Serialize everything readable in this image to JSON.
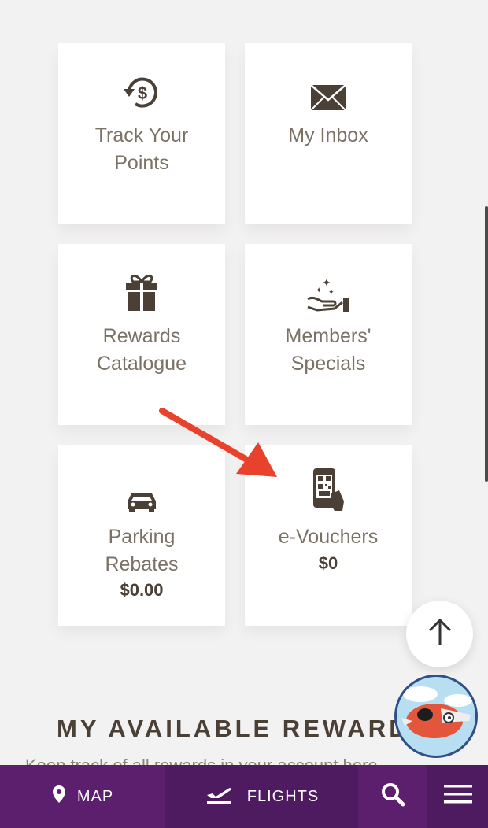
{
  "tiles": {
    "track_points": {
      "label": "Track Your\nPoints",
      "icon": "dollar-history-icon"
    },
    "inbox": {
      "label": "My Inbox",
      "icon": "envelope-icon"
    },
    "rewards_catalogue": {
      "label": "Rewards\nCatalogue",
      "icon": "gift-icon"
    },
    "members_specials": {
      "label": "Members'\nSpecials",
      "icon": "sparkle-hand-icon"
    },
    "parking_rebates": {
      "label": "Parking\nRebates",
      "amount": "$0.00",
      "icon": "car-icon"
    },
    "e_vouchers": {
      "label": "e-Vouchers",
      "amount": "$0",
      "icon": "phone-qr-icon"
    }
  },
  "section": {
    "title": "MY AVAILABLE REWARDS",
    "subtitle": "Keep track of all rewards in your account here"
  },
  "bottom_nav": {
    "map": "MAP",
    "flights": "FLIGHTS"
  },
  "colors": {
    "nav_purple": "#5b1f6e",
    "text_brown": "#7b7164",
    "annotation_red": "#e8422d"
  }
}
